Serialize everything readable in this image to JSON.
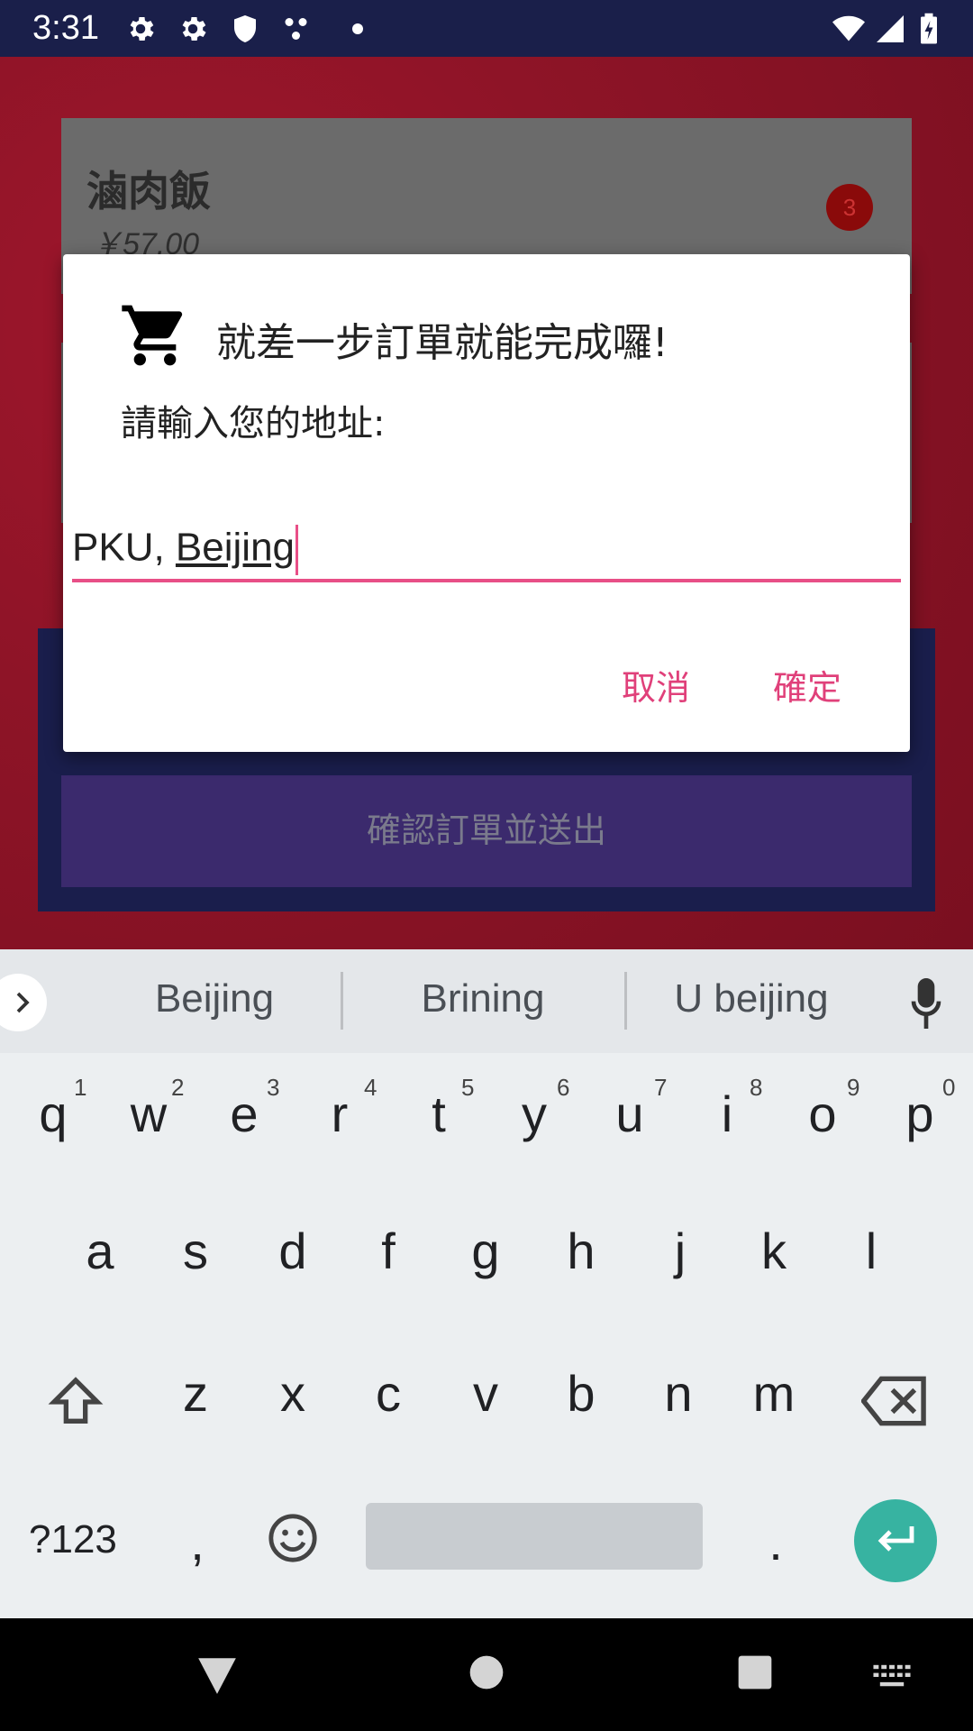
{
  "status_bar": {
    "time": "3:31",
    "left_icons": [
      "gear-icon",
      "gear-icon",
      "shield-icon",
      "dots-icon",
      "small-dot-icon"
    ],
    "right_icons": [
      "wifi-icon",
      "signal-icon",
      "battery-icon"
    ]
  },
  "background_screen": {
    "item_name": "滷肉飯",
    "item_price": "￥57.00",
    "item_count_badge": "3",
    "confirm_order_button": "確認訂單並送出"
  },
  "dialog": {
    "icon": "cart-icon",
    "title": "就差一步訂單就能完成囉!",
    "message": "請輸入您的地址:",
    "input_prefix": "PKU, ",
    "input_word": "Beijing",
    "cancel_label": "取消",
    "ok_label": "確定",
    "accent_color": "#e84f87"
  },
  "keyboard": {
    "suggestions": [
      "Beijing",
      "Brining",
      "U beijing"
    ],
    "row1": [
      "q",
      "w",
      "e",
      "r",
      "t",
      "y",
      "u",
      "i",
      "o",
      "p"
    ],
    "row1_hints": [
      "1",
      "2",
      "3",
      "4",
      "5",
      "6",
      "7",
      "8",
      "9",
      "0"
    ],
    "row2": [
      "a",
      "s",
      "d",
      "f",
      "g",
      "h",
      "j",
      "k",
      "l"
    ],
    "row3": [
      "z",
      "x",
      "c",
      "v",
      "b",
      "n",
      "m"
    ],
    "symbols_label": "?123",
    "comma": ",",
    "period": ".",
    "enter_color": "#37b3a1"
  },
  "nav_bar": {
    "icons": [
      "back-icon",
      "home-icon",
      "recents-icon",
      "keyboard-switch-icon"
    ]
  }
}
